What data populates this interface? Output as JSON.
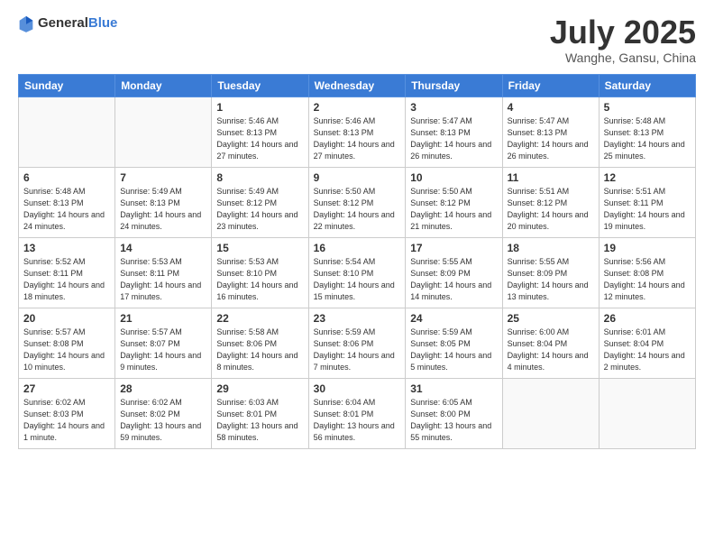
{
  "header": {
    "logo_general": "General",
    "logo_blue": "Blue",
    "title": "July 2025",
    "location": "Wanghe, Gansu, China"
  },
  "days_of_week": [
    "Sunday",
    "Monday",
    "Tuesday",
    "Wednesday",
    "Thursday",
    "Friday",
    "Saturday"
  ],
  "weeks": [
    [
      {
        "day": "",
        "info": ""
      },
      {
        "day": "",
        "info": ""
      },
      {
        "day": "1",
        "info": "Sunrise: 5:46 AM\nSunset: 8:13 PM\nDaylight: 14 hours and 27 minutes."
      },
      {
        "day": "2",
        "info": "Sunrise: 5:46 AM\nSunset: 8:13 PM\nDaylight: 14 hours and 27 minutes."
      },
      {
        "day": "3",
        "info": "Sunrise: 5:47 AM\nSunset: 8:13 PM\nDaylight: 14 hours and 26 minutes."
      },
      {
        "day": "4",
        "info": "Sunrise: 5:47 AM\nSunset: 8:13 PM\nDaylight: 14 hours and 26 minutes."
      },
      {
        "day": "5",
        "info": "Sunrise: 5:48 AM\nSunset: 8:13 PM\nDaylight: 14 hours and 25 minutes."
      }
    ],
    [
      {
        "day": "6",
        "info": "Sunrise: 5:48 AM\nSunset: 8:13 PM\nDaylight: 14 hours and 24 minutes."
      },
      {
        "day": "7",
        "info": "Sunrise: 5:49 AM\nSunset: 8:13 PM\nDaylight: 14 hours and 24 minutes."
      },
      {
        "day": "8",
        "info": "Sunrise: 5:49 AM\nSunset: 8:12 PM\nDaylight: 14 hours and 23 minutes."
      },
      {
        "day": "9",
        "info": "Sunrise: 5:50 AM\nSunset: 8:12 PM\nDaylight: 14 hours and 22 minutes."
      },
      {
        "day": "10",
        "info": "Sunrise: 5:50 AM\nSunset: 8:12 PM\nDaylight: 14 hours and 21 minutes."
      },
      {
        "day": "11",
        "info": "Sunrise: 5:51 AM\nSunset: 8:12 PM\nDaylight: 14 hours and 20 minutes."
      },
      {
        "day": "12",
        "info": "Sunrise: 5:51 AM\nSunset: 8:11 PM\nDaylight: 14 hours and 19 minutes."
      }
    ],
    [
      {
        "day": "13",
        "info": "Sunrise: 5:52 AM\nSunset: 8:11 PM\nDaylight: 14 hours and 18 minutes."
      },
      {
        "day": "14",
        "info": "Sunrise: 5:53 AM\nSunset: 8:11 PM\nDaylight: 14 hours and 17 minutes."
      },
      {
        "day": "15",
        "info": "Sunrise: 5:53 AM\nSunset: 8:10 PM\nDaylight: 14 hours and 16 minutes."
      },
      {
        "day": "16",
        "info": "Sunrise: 5:54 AM\nSunset: 8:10 PM\nDaylight: 14 hours and 15 minutes."
      },
      {
        "day": "17",
        "info": "Sunrise: 5:55 AM\nSunset: 8:09 PM\nDaylight: 14 hours and 14 minutes."
      },
      {
        "day": "18",
        "info": "Sunrise: 5:55 AM\nSunset: 8:09 PM\nDaylight: 14 hours and 13 minutes."
      },
      {
        "day": "19",
        "info": "Sunrise: 5:56 AM\nSunset: 8:08 PM\nDaylight: 14 hours and 12 minutes."
      }
    ],
    [
      {
        "day": "20",
        "info": "Sunrise: 5:57 AM\nSunset: 8:08 PM\nDaylight: 14 hours and 10 minutes."
      },
      {
        "day": "21",
        "info": "Sunrise: 5:57 AM\nSunset: 8:07 PM\nDaylight: 14 hours and 9 minutes."
      },
      {
        "day": "22",
        "info": "Sunrise: 5:58 AM\nSunset: 8:06 PM\nDaylight: 14 hours and 8 minutes."
      },
      {
        "day": "23",
        "info": "Sunrise: 5:59 AM\nSunset: 8:06 PM\nDaylight: 14 hours and 7 minutes."
      },
      {
        "day": "24",
        "info": "Sunrise: 5:59 AM\nSunset: 8:05 PM\nDaylight: 14 hours and 5 minutes."
      },
      {
        "day": "25",
        "info": "Sunrise: 6:00 AM\nSunset: 8:04 PM\nDaylight: 14 hours and 4 minutes."
      },
      {
        "day": "26",
        "info": "Sunrise: 6:01 AM\nSunset: 8:04 PM\nDaylight: 14 hours and 2 minutes."
      }
    ],
    [
      {
        "day": "27",
        "info": "Sunrise: 6:02 AM\nSunset: 8:03 PM\nDaylight: 14 hours and 1 minute."
      },
      {
        "day": "28",
        "info": "Sunrise: 6:02 AM\nSunset: 8:02 PM\nDaylight: 13 hours and 59 minutes."
      },
      {
        "day": "29",
        "info": "Sunrise: 6:03 AM\nSunset: 8:01 PM\nDaylight: 13 hours and 58 minutes."
      },
      {
        "day": "30",
        "info": "Sunrise: 6:04 AM\nSunset: 8:01 PM\nDaylight: 13 hours and 56 minutes."
      },
      {
        "day": "31",
        "info": "Sunrise: 6:05 AM\nSunset: 8:00 PM\nDaylight: 13 hours and 55 minutes."
      },
      {
        "day": "",
        "info": ""
      },
      {
        "day": "",
        "info": ""
      }
    ]
  ]
}
